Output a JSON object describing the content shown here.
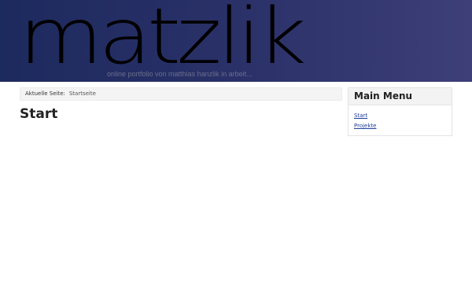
{
  "header": {
    "logo": "matzlik",
    "tagline": "online portfolio von matthias hanzlik in arbeit..."
  },
  "breadcrumb": {
    "label": "Aktuelle Seite:",
    "current": "Startseite"
  },
  "main": {
    "title": "Start"
  },
  "menu": {
    "title": "Main Menu",
    "items": [
      {
        "label": "Start"
      },
      {
        "label": "Projekte"
      }
    ]
  }
}
